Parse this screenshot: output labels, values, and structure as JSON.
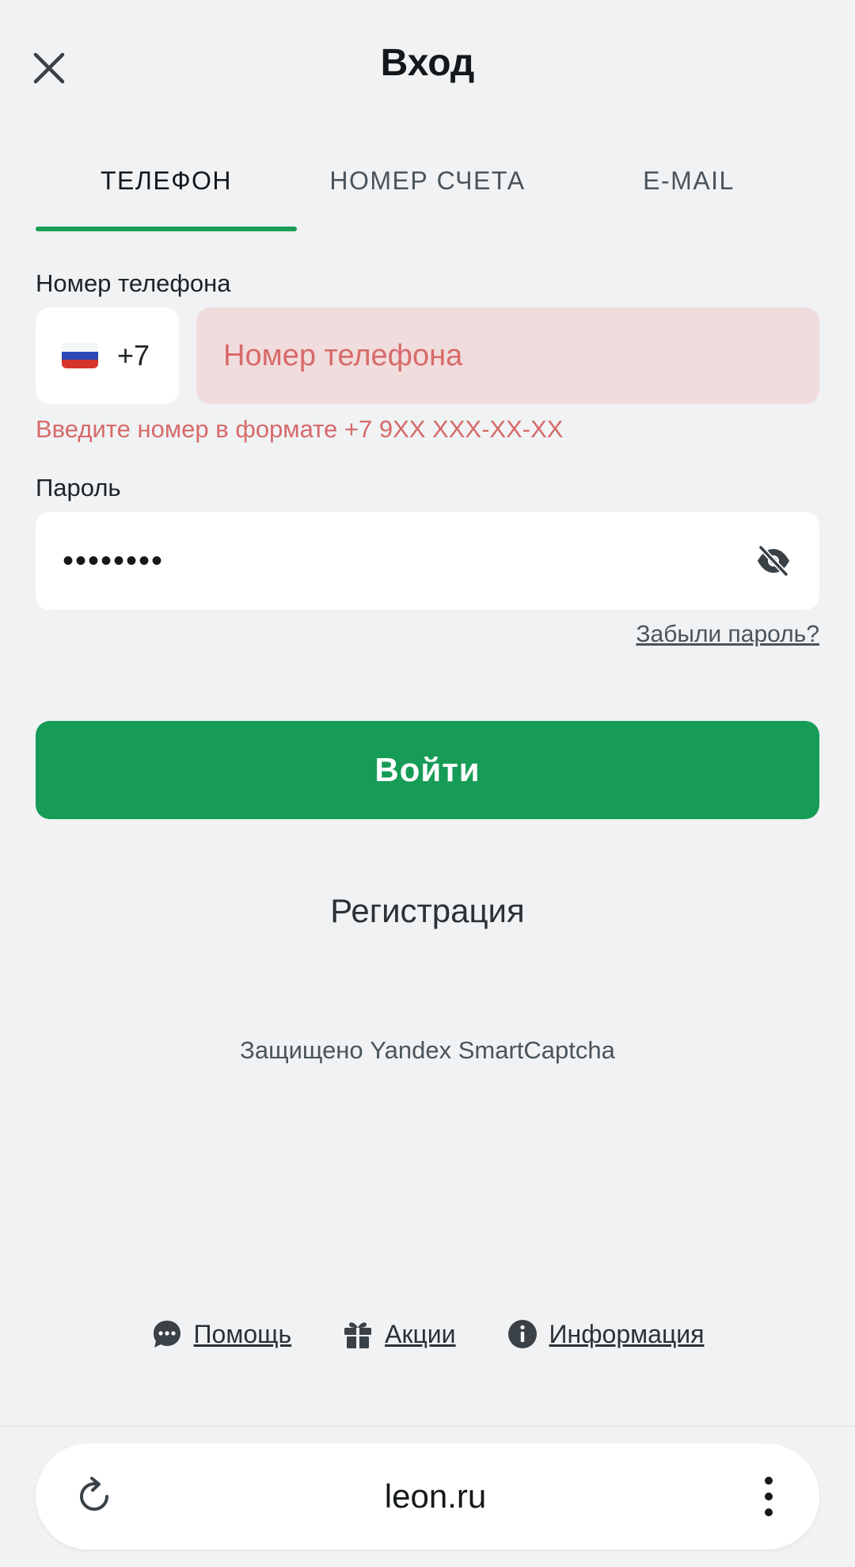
{
  "header": {
    "title": "Вход",
    "close_icon": "close-icon"
  },
  "tabs": [
    {
      "label": "ТЕЛЕФОН",
      "active": true
    },
    {
      "label": "НОМЕР СЧЕТА",
      "active": false
    },
    {
      "label": "E-MAIL",
      "active": false
    }
  ],
  "phone": {
    "label": "Номер телефона",
    "country_code": "+7",
    "flag_icon": "russia-flag-icon",
    "placeholder": "Номер телефона",
    "value": "",
    "error": "Введите номер в формате +7 9XX XXX-XX-XX"
  },
  "password": {
    "label": "Пароль",
    "value": "••••••••",
    "toggle_icon": "eye-off-icon"
  },
  "forgot_password": "Забыли пароль?",
  "login_button": "Войти",
  "register_link": "Регистрация",
  "captcha_note": "Защищено Yandex SmartCaptcha",
  "footer": {
    "links": [
      {
        "label": "Помощь",
        "icon": "chat-icon"
      },
      {
        "label": "Акции",
        "icon": "gift-icon"
      },
      {
        "label": "Информация",
        "icon": "info-icon"
      }
    ]
  },
  "browser": {
    "url": "leon.ru",
    "reload_icon": "reload-icon",
    "menu_icon": "more-vertical-icon"
  },
  "colors": {
    "accent": "#169c56",
    "error": "#d76a6a",
    "error_bg": "#f1dcdd",
    "background": "#f0f2f4"
  }
}
